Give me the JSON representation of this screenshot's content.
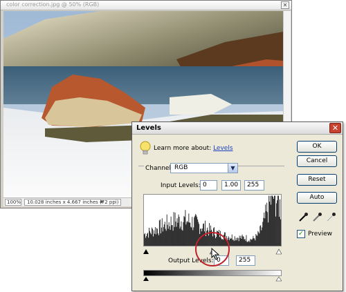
{
  "photo_window": {
    "title": "color correction.jpg @ 50% (RGB)",
    "close_glyph": "✕",
    "zoom": "100%",
    "doc_info": "10.028 inches x 4.667 inches (72 ppi)",
    "status_arrow": "▶"
  },
  "levels": {
    "title": "Levels",
    "close_glyph": "✕",
    "learn_prefix": "Learn more about: ",
    "learn_link": "Levels",
    "channel_label": "Channel:",
    "channel_value": "RGB",
    "channel_arrow": "▼",
    "input_levels_label": "Input Levels:",
    "input_black": "0",
    "input_gamma": "1.00",
    "input_white": "255",
    "output_levels_label": "Output Levels:",
    "output_black": "0",
    "output_white": "255",
    "buttons": {
      "ok": "OK",
      "cancel": "Cancel",
      "reset": "Reset",
      "auto": "Auto"
    },
    "preview_label": "Preview",
    "preview_checked": "✓",
    "icons": [
      "lightbulb-icon",
      "black-eyedropper-icon",
      "gray-eyedropper-icon",
      "white-eyedropper-icon",
      "cursor-icon"
    ],
    "accent_colors": {
      "close": "#c8432f",
      "link": "#1a3ec2",
      "highlight": "#c0202a"
    }
  }
}
